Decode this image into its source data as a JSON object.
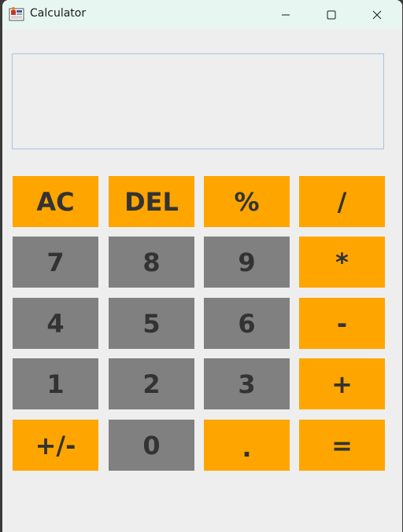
{
  "window": {
    "title": "Calculator",
    "minimize_icon": "minimize-icon",
    "maximize_icon": "maximize-icon",
    "close_icon": "close-icon"
  },
  "display": {
    "value": ""
  },
  "colors": {
    "operator": "#ffa500",
    "digit": "#808080",
    "text": "#333333",
    "background": "#eeeeee"
  },
  "keys": {
    "ac": "AC",
    "del": "DEL",
    "percent": "%",
    "divide": "/",
    "seven": "7",
    "eight": "8",
    "nine": "9",
    "multiply": "*",
    "four": "4",
    "five": "5",
    "six": "6",
    "minus": "-",
    "one": "1",
    "two": "2",
    "three": "3",
    "plus": "+",
    "negate": "+/-",
    "zero": "0",
    "decimal": ".",
    "equals": "="
  }
}
